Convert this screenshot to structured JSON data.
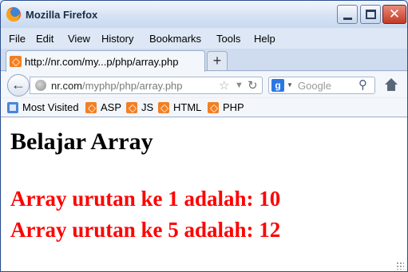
{
  "window": {
    "title": "Mozilla Firefox"
  },
  "menu": [
    "File",
    "Edit",
    "View",
    "History",
    "Bookmarks",
    "Tools",
    "Help"
  ],
  "tab": {
    "title": "http://nr.com/my...p/php/array.php",
    "new_tab_label": "+"
  },
  "navbar": {
    "url_host": "nr.com",
    "url_path": "/myphp/php/array.php",
    "search_placeholder": "Google",
    "search_engine_badge": "g"
  },
  "bookmarks": [
    "Most Visited",
    "ASP",
    "JS",
    "HTML",
    "PHP"
  ],
  "page": {
    "heading": "Belajar Array",
    "lines": [
      "Array urutan ke 1 adalah: 10",
      "Array urutan ke 5 adalah: 12"
    ]
  },
  "colors": {
    "result_text": "#ff0000",
    "favicon": "#f37f22"
  }
}
